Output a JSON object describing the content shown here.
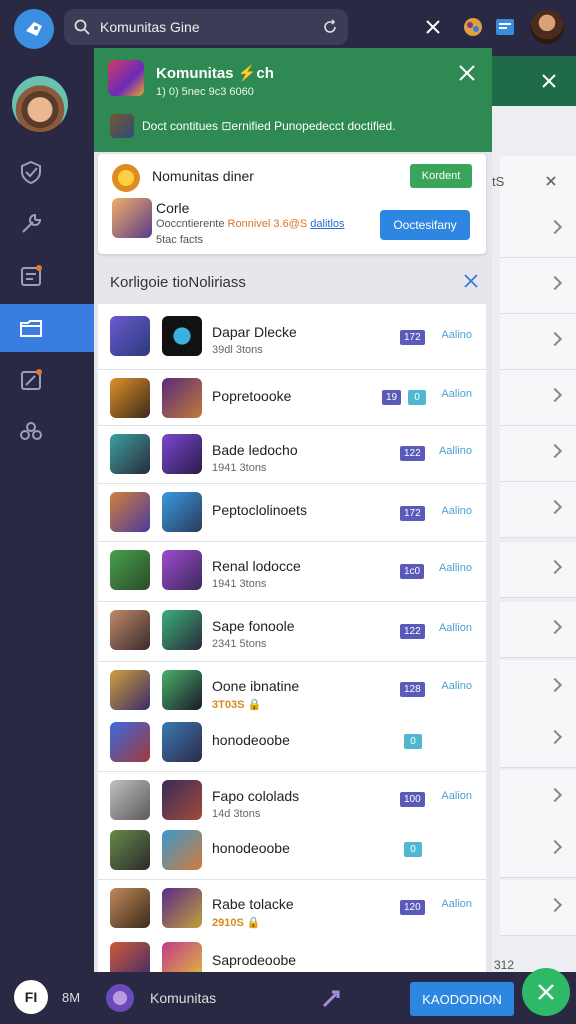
{
  "search": {
    "value": "Komunitas Gine"
  },
  "banner": {
    "title": "Komunitas ⚡ch",
    "subtitle": "1) 0) 5nec 9c3 6060",
    "message": "Doct contitues ⊡ernified Punopedecct doctified."
  },
  "card": {
    "title": "Nomunitas diner",
    "button1": "Kordent",
    "name": "Corle",
    "line_text": "Ooccntierente",
    "line_orange": "Ronnivel 3.6@S",
    "line_link": "dalitlos",
    "line3": "5tac facts",
    "button2": "Ooctesifany"
  },
  "section": {
    "title": "Korligoie tioNoliriass"
  },
  "rows": [
    {
      "title": "Dapar Dlecke",
      "sub": "39dl 3tons",
      "badge": "172",
      "action": "Aalino"
    },
    {
      "title": "Popretoooke",
      "badge": "19",
      "badge2": "0",
      "action": "Aalion"
    },
    {
      "title": "Bade ledocho",
      "sub": "1941 3tons",
      "badge": "122",
      "action": "Aallino"
    },
    {
      "title": "Peptoclolinoets",
      "badge": "172",
      "action": "Aalino"
    },
    {
      "title": "Renal lodocce",
      "sub": "1941 3tons",
      "badge": "1c0",
      "action": "Aallino"
    },
    {
      "title": "Sape fonoole",
      "sub": "2341 5tons",
      "badge": "122",
      "action": "Aallion"
    },
    {
      "title": "Oone ibnatine",
      "sub": "3T03S 🔒",
      "badge": "128",
      "action": "Aalino"
    },
    {
      "title": "honodeoobe",
      "badge": "0"
    },
    {
      "title": "Fapo cololads",
      "sub": "14d 3tons",
      "badge": "100",
      "action": "Aalion"
    },
    {
      "title": "honodeoobe",
      "badge": "0"
    },
    {
      "title": "Rabe tolacke",
      "sub": "2910S 🔒",
      "badge": "120",
      "action": "Aalion"
    },
    {
      "title": "Saprodeoobe"
    }
  ],
  "bg_panel": {
    "row_label": "tS",
    "partial": "312"
  },
  "bottom": {
    "logo": "FI",
    "sm": "8M",
    "name": "Komunitas",
    "button": "KAODODION"
  },
  "colors": {
    "accent": "#2d86e0",
    "banner": "#2e8a52",
    "fab": "#2fb865",
    "sidebar": "#2a2944"
  }
}
